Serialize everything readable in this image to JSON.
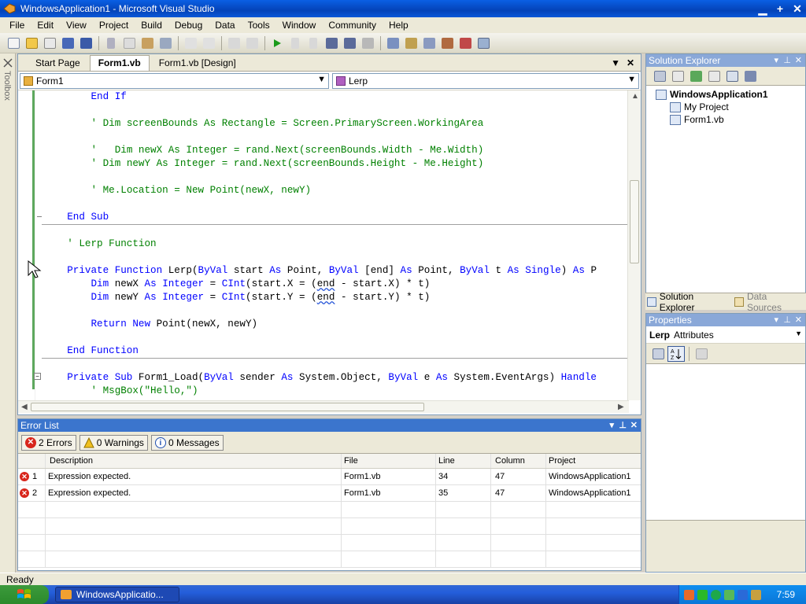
{
  "window": {
    "title": "WindowsApplication1 - Microsoft Visual Studio",
    "min": "▁",
    "max": "+",
    "close": "✕"
  },
  "menu": [
    "File",
    "Edit",
    "View",
    "Project",
    "Build",
    "Debug",
    "Data",
    "Tools",
    "Window",
    "Community",
    "Help"
  ],
  "toolbox": {
    "label": "Toolbox"
  },
  "doc_tabs": {
    "items": [
      "Start Page",
      "Form1.vb",
      "Form1.vb [Design]"
    ],
    "active": 1,
    "dropdown": "▼",
    "close": "✕"
  },
  "nav": {
    "left_combo": "Form1",
    "right_combo": "Lerp"
  },
  "code_lines": [
    [
      [
        "",
        "        "
      ],
      [
        "kw",
        "End If"
      ]
    ],
    [],
    [
      [
        "",
        "        "
      ],
      [
        "cm",
        "' Dim screenBounds As Rectangle = Screen.PrimaryScreen.WorkingArea"
      ]
    ],
    [],
    [
      [
        "",
        "        "
      ],
      [
        "cm",
        "'   Dim newX As Integer = rand.Next(screenBounds.Width - Me.Width)"
      ]
    ],
    [
      [
        "",
        "        "
      ],
      [
        "cm",
        "' Dim newY As Integer = rand.Next(screenBounds.Height - Me.Height)"
      ]
    ],
    [],
    [
      [
        "",
        "        "
      ],
      [
        "cm",
        "' Me.Location = New Point(newX, newY)"
      ]
    ],
    [],
    [
      [
        "",
        "    "
      ],
      [
        "kw",
        "End Sub"
      ]
    ],
    [],
    [
      [
        "",
        "    "
      ],
      [
        "cm",
        "' Lerp Function"
      ]
    ],
    [],
    [
      [
        "",
        "    "
      ],
      [
        "kw",
        "Private Function"
      ],
      [
        "",
        " Lerp("
      ],
      [
        "kw",
        "ByVal"
      ],
      [
        "",
        " start "
      ],
      [
        "kw",
        "As"
      ],
      [
        "",
        " Point, "
      ],
      [
        "kw",
        "ByVal"
      ],
      [
        "",
        " [end] "
      ],
      [
        "kw",
        "As"
      ],
      [
        "",
        " Point, "
      ],
      [
        "kw",
        "ByVal"
      ],
      [
        "",
        " t "
      ],
      [
        "kw",
        "As"
      ],
      [
        "",
        " "
      ],
      [
        "kw",
        "Single"
      ],
      [
        "",
        ") "
      ],
      [
        "kw",
        "As"
      ],
      [
        "",
        " P"
      ]
    ],
    [
      [
        "",
        "        "
      ],
      [
        "kw",
        "Dim"
      ],
      [
        "",
        " newX "
      ],
      [
        "kw",
        "As Integer"
      ],
      [
        "",
        " = "
      ],
      [
        "kw",
        "CInt"
      ],
      [
        "",
        "(start.X = ("
      ],
      [
        "squig",
        "end"
      ],
      [
        "",
        " - start.X) * t)"
      ]
    ],
    [
      [
        "",
        "        "
      ],
      [
        "kw",
        "Dim"
      ],
      [
        "",
        " newY "
      ],
      [
        "kw",
        "As Integer"
      ],
      [
        "",
        " = "
      ],
      [
        "kw",
        "CInt"
      ],
      [
        "",
        "(start.Y = ("
      ],
      [
        "squig",
        "end"
      ],
      [
        "",
        " - start.Y) * t)"
      ]
    ],
    [],
    [
      [
        "",
        "        "
      ],
      [
        "kw",
        "Return New"
      ],
      [
        "",
        " Point(newX, newY)"
      ]
    ],
    [],
    [
      [
        "",
        "    "
      ],
      [
        "kw",
        "End Function"
      ]
    ],
    [],
    [
      [
        "",
        "    "
      ],
      [
        "kw",
        "Private Sub"
      ],
      [
        "",
        " Form1_Load("
      ],
      [
        "kw",
        "ByVal"
      ],
      [
        "",
        " sender "
      ],
      [
        "kw",
        "As"
      ],
      [
        "",
        " System.Object, "
      ],
      [
        "kw",
        "ByVal"
      ],
      [
        "",
        " e "
      ],
      [
        "kw",
        "As"
      ],
      [
        "",
        " System.EventArgs) "
      ],
      [
        "kw",
        "Handle"
      ]
    ],
    [
      [
        "",
        "        "
      ],
      [
        "cm",
        "' MsgBox(\"Hello,\")"
      ]
    ]
  ],
  "error_list": {
    "title": "Error List",
    "filters": {
      "errors": "2 Errors",
      "warnings": "0 Warnings",
      "messages": "0 Messages"
    },
    "columns": {
      "description": "Description",
      "file": "File",
      "line": "Line",
      "column": "Column",
      "project": "Project"
    },
    "rows": [
      {
        "num": "1",
        "description": "Expression expected.",
        "file": "Form1.vb",
        "line": "34",
        "column": "47",
        "project": "WindowsApplication1"
      },
      {
        "num": "2",
        "description": "Expression expected.",
        "file": "Form1.vb",
        "line": "35",
        "column": "47",
        "project": "WindowsApplication1"
      }
    ]
  },
  "solution_explorer": {
    "title": "Solution Explorer",
    "items": [
      "WindowsApplication1",
      "My Project",
      "Form1.vb"
    ]
  },
  "sol_tabs": [
    "Solution Explorer",
    "Data Sources"
  ],
  "properties": {
    "title": "Properties",
    "object": "Lerp",
    "object_type": "Attributes"
  },
  "status": "Ready",
  "taskbar": {
    "task": "WindowsApplicatio...",
    "clock": "7:59"
  },
  "colors": {
    "keyword": "#0000ff",
    "comment": "#008000",
    "title_bar": "#0a5fe4",
    "error": "#d8261c"
  }
}
